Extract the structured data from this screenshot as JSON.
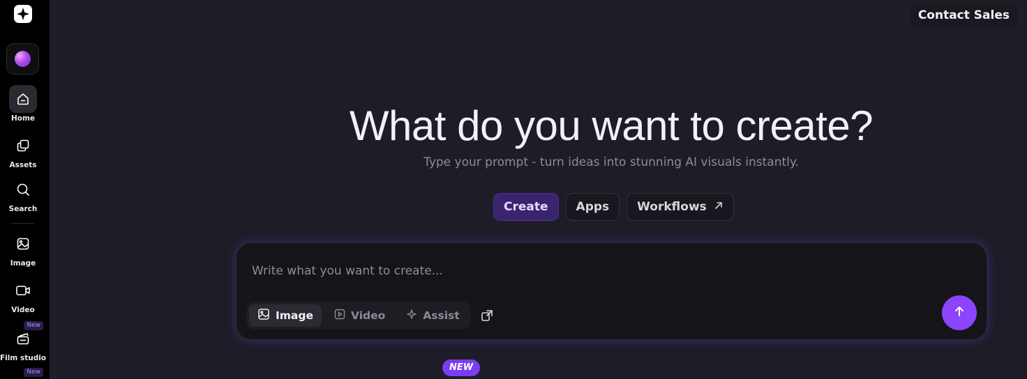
{
  "header": {
    "contact_label": "Contact Sales"
  },
  "sidebar": {
    "items": [
      {
        "label": "Home",
        "icon": "home-icon",
        "active": true
      },
      {
        "label": "Assets",
        "icon": "assets-icon"
      },
      {
        "label": "Search",
        "icon": "search-icon"
      },
      {
        "label": "Image",
        "icon": "image-icon"
      },
      {
        "label": "Video",
        "icon": "video-icon",
        "badge": "New"
      },
      {
        "label": "Film studio",
        "icon": "clapperboard-icon",
        "badge": "New"
      }
    ]
  },
  "hero": {
    "title": "What do you want to create?",
    "subtitle": "Type your prompt - turn ideas into stunning AI visuals instantly."
  },
  "mode_tabs": [
    {
      "label": "Create",
      "active": true
    },
    {
      "label": "Apps"
    },
    {
      "label": "Workflows",
      "icon": "arrow-up-right-icon"
    }
  ],
  "prompt": {
    "placeholder": "Write what you want to create...",
    "types": [
      {
        "label": "Image",
        "icon": "image-icon",
        "active": true
      },
      {
        "label": "Video",
        "icon": "video-icon"
      },
      {
        "label": "Assist",
        "icon": "sparkle-icon"
      }
    ]
  },
  "new_badge": "NEW",
  "colors": {
    "background": "#1d1d28",
    "sidebar": "#000000",
    "accent": "#8c44ff",
    "active_tab": "#3a2470"
  }
}
